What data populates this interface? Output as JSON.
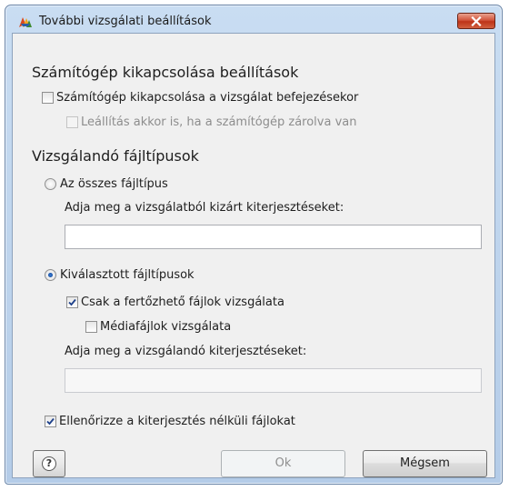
{
  "window": {
    "title": "További vizsgálati beállítások",
    "app_icon": "avg-logo-icon",
    "close_icon": "close-icon"
  },
  "shutdown_section": {
    "heading": "Számítógép kikapcsolása beállítások",
    "shutdown_after_scan": {
      "label": "Számítógép kikapcsolása a vizsgálat befejezésekor",
      "checked": false
    },
    "force_shutdown_locked": {
      "label": "Leállítás akkor is, ha a számítógép zárolva van",
      "checked": false,
      "enabled": false
    }
  },
  "filetypes_section": {
    "heading": "Vizsgálandó fájltípusok",
    "all_types": {
      "label": "Az összes fájltípus",
      "selected": false
    },
    "excluded_ext_label": "Adja meg a vizsgálatból kizárt kiterjesztéseket:",
    "excluded_ext_value": "",
    "selected_types": {
      "label": "Kiválasztott fájltípusok",
      "selected": true
    },
    "infectable_only": {
      "label": "Csak a fertőzhető fájlok vizsgálata",
      "checked": true
    },
    "media_files": {
      "label": "Médiafájlok vizsgálata",
      "checked": false
    },
    "included_ext_label": "Adja meg a vizsgálandó kiterjesztéseket:",
    "included_ext_value": "",
    "no_extension": {
      "label": "Ellenőrizze a kiterjesztés nélküli fájlokat",
      "checked": true
    }
  },
  "footer": {
    "help_icon": "help-icon",
    "help_glyph": "?",
    "ok_label": "Ok",
    "ok_enabled": false,
    "cancel_label": "Mégsem"
  },
  "colors": {
    "title_bar": "#c9ddf2",
    "client_bg": "#f0f0f0",
    "close_button": "#c8452a",
    "check_mark": "#1c3f8a",
    "radio_dot": "#0b3e8c"
  }
}
